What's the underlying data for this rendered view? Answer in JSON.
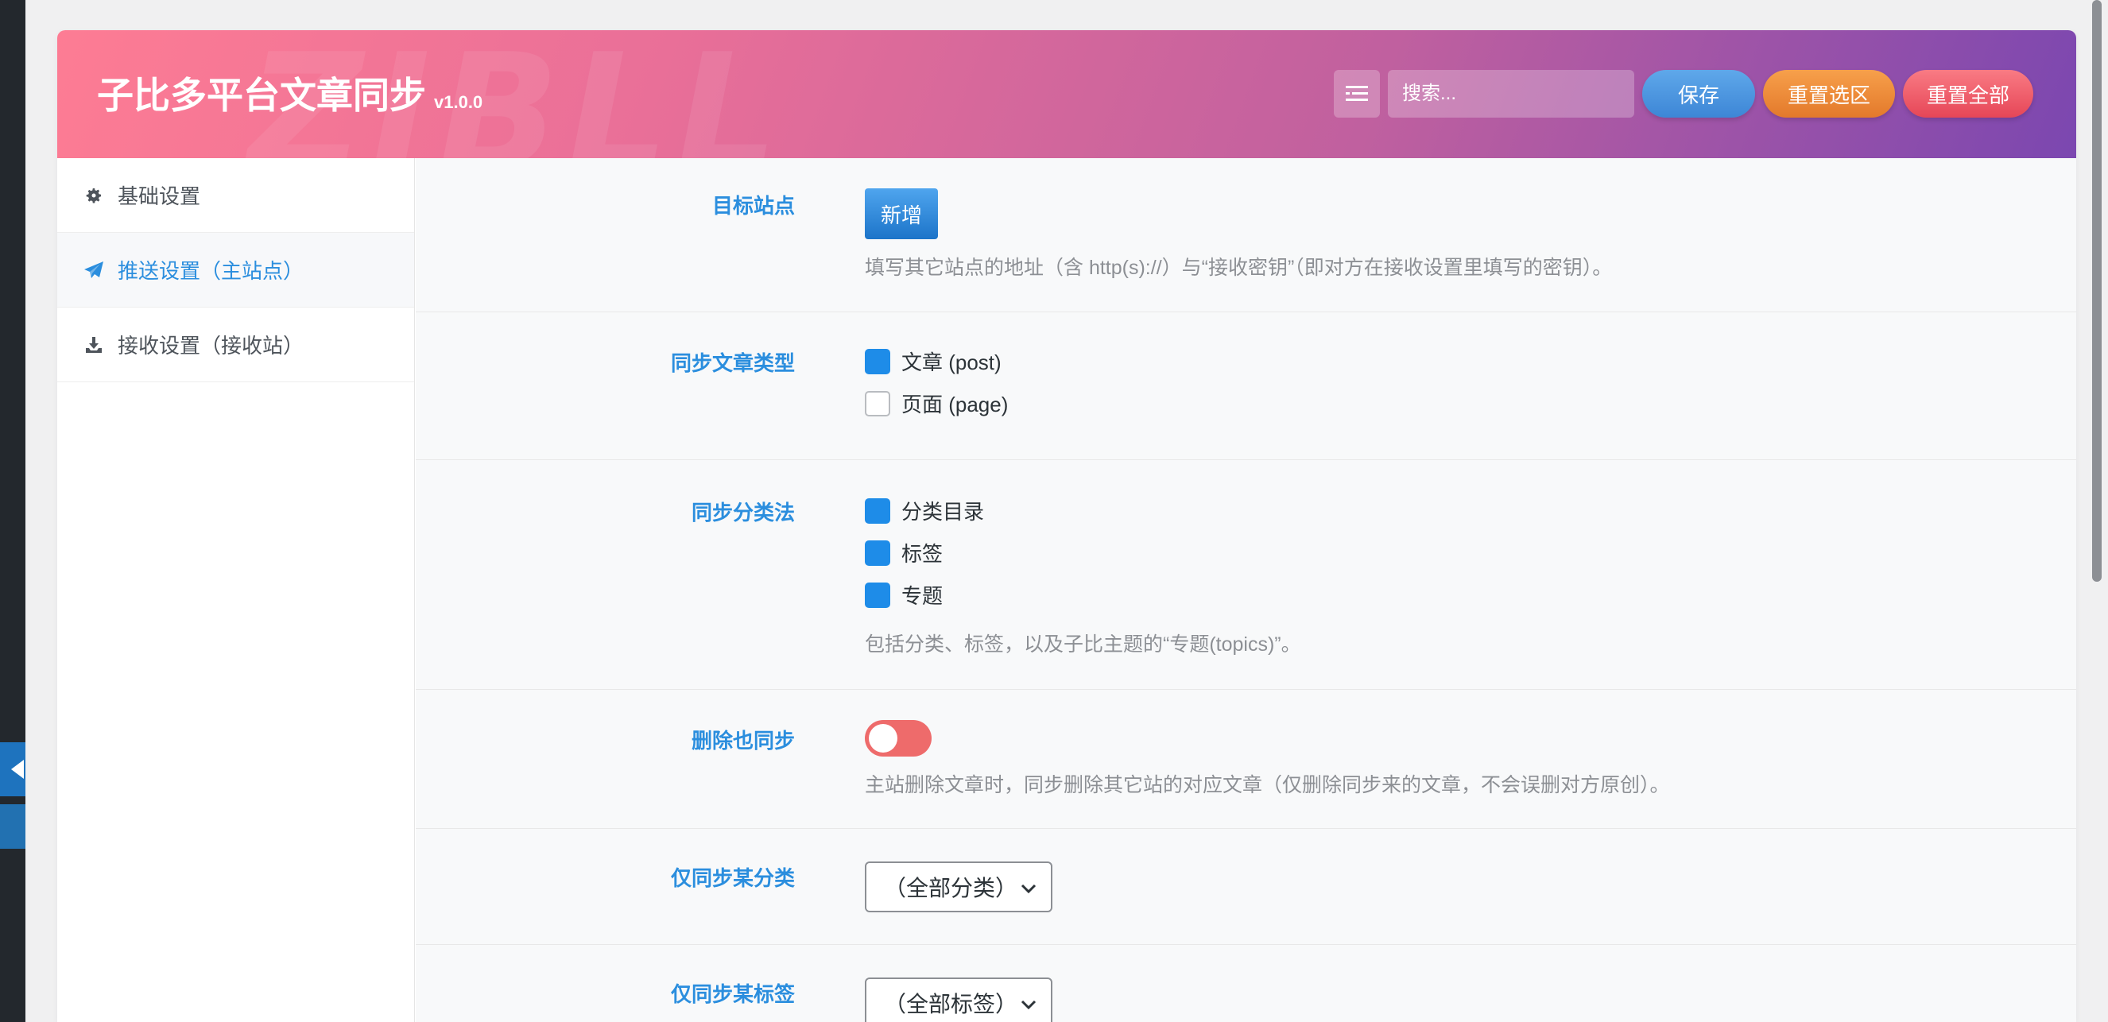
{
  "header": {
    "title": "子比多平台文章同步",
    "version": "v1.0.0",
    "watermark": "ZIBLL",
    "search_placeholder": "搜索...",
    "save_label": "保存",
    "reset_section_label": "重置选区",
    "reset_all_label": "重置全部"
  },
  "sidebar": {
    "items": [
      {
        "label": "基础设置",
        "icon": "gear-icon"
      },
      {
        "label": "推送设置（主站点）",
        "icon": "paper-plane-icon"
      },
      {
        "label": "接收设置（接收站）",
        "icon": "download-icon"
      }
    ],
    "active_index": 1
  },
  "fields": {
    "target_sites": {
      "label": "目标站点",
      "button": "新增",
      "desc": "填写其它站点的地址（含 http(s)://）与“接收密钥”（即对方在接收设置里填写的密钥）。"
    },
    "post_types": {
      "label": "同步文章类型",
      "options": [
        {
          "label": "文章 (post)",
          "checked": true
        },
        {
          "label": "页面 (page)",
          "checked": false
        }
      ]
    },
    "taxonomies": {
      "label": "同步分类法",
      "options": [
        {
          "label": "分类目录",
          "checked": true
        },
        {
          "label": "标签",
          "checked": true
        },
        {
          "label": "专题",
          "checked": true
        }
      ],
      "desc": "包括分类、标签，以及子比主题的“专题(topics)”。"
    },
    "sync_delete": {
      "label": "删除也同步",
      "enabled": false,
      "desc": "主站删除文章时，同步删除其它站的对应文章（仅删除同步来的文章，不会误删对方原创）。"
    },
    "only_category": {
      "label": "仅同步某分类",
      "value": "（全部分类）"
    },
    "only_tag": {
      "label": "仅同步某标签",
      "value": "（全部标签）"
    }
  },
  "colors": {
    "accent": "#2b8ede",
    "checkbox_on": "#1e8ce8",
    "toggle_off": "#ee6b6b"
  }
}
